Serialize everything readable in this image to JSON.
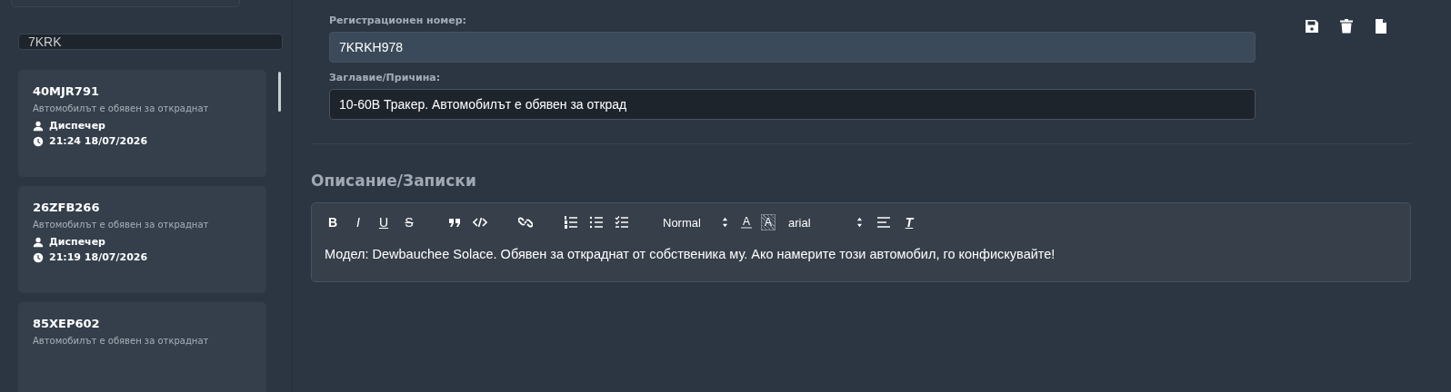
{
  "search": {
    "value": "7KRK"
  },
  "reports": [
    {
      "plate": "40MJR791",
      "reason": "Автомобилът е обявен за откраднат",
      "author": "Диспечер",
      "time": "21:24 18/07/2026"
    },
    {
      "plate": "26ZFB266",
      "reason": "Автомобилът е обявен за откраднат",
      "author": "Диспечер",
      "time": "21:19 18/07/2026"
    },
    {
      "plate": "85XEP602",
      "reason": "Автомобилът е обявен за откраднат"
    }
  ],
  "form": {
    "plate_label": "Регистрационен номер:",
    "plate_value": "7KRKH978",
    "title_label": "Заглавие/Причина:",
    "title_value": "10-60В Тракер. Автомобилът е обявен за открад"
  },
  "actions": [
    {
      "kind": "save"
    },
    {
      "kind": "delete"
    },
    {
      "kind": "new"
    }
  ],
  "notes": {
    "heading": "Описание/Записки",
    "toolbar": [
      {
        "kind": "bold",
        "label": "B"
      },
      {
        "kind": "italic",
        "label": "I"
      },
      {
        "kind": "underline",
        "label": "U"
      },
      {
        "kind": "strike",
        "label": "S"
      },
      {
        "kind": "sep"
      },
      {
        "kind": "quote"
      },
      {
        "kind": "code"
      },
      {
        "kind": "sep"
      },
      {
        "kind": "link"
      },
      {
        "kind": "sep"
      },
      {
        "kind": "ordered"
      },
      {
        "kind": "bullet"
      },
      {
        "kind": "check"
      },
      {
        "kind": "sep"
      },
      {
        "kind": "select",
        "label": "Normal"
      },
      {
        "kind": "color",
        "label": "A"
      },
      {
        "kind": "background",
        "label": "A"
      },
      {
        "kind": "select",
        "label": "arial"
      },
      {
        "kind": "align"
      },
      {
        "kind": "clean",
        "label": "T"
      }
    ],
    "text": "Модел: Dewbauchee Solace. Обявен за откраднат от собственика му. Ако намерите този автомобил, го конфискувайте!"
  }
}
